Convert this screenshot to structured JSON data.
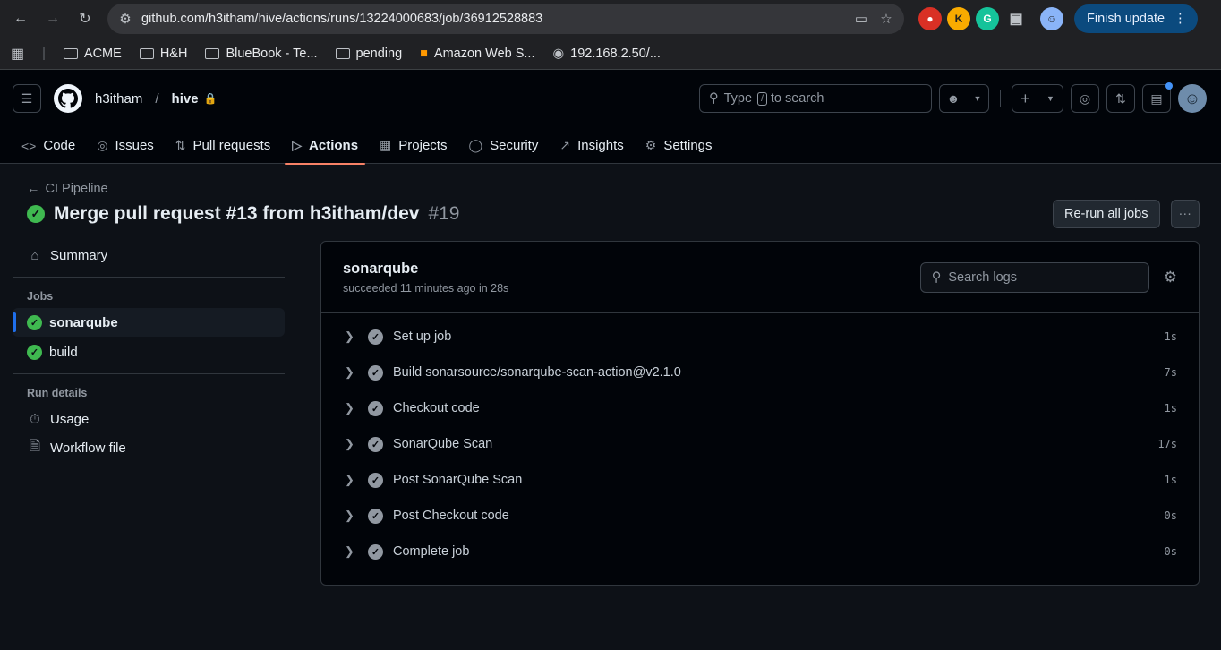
{
  "browser": {
    "url": "github.com/h3itham/hive/actions/runs/13224000683/job/36912528883",
    "finish_update": "Finish update",
    "bookmarks": [
      "ACME",
      "H&H",
      "BlueBook - Te...",
      "pending",
      "Amazon Web S...",
      "192.168.2.50/..."
    ]
  },
  "header": {
    "owner": "h3itham",
    "separator": "/",
    "repo": "hive",
    "search_placeholder_pre": "Type",
    "search_key": "/",
    "search_placeholder_post": "to search"
  },
  "tabs": [
    {
      "label": "Code",
      "icon": "code-icon"
    },
    {
      "label": "Issues",
      "icon": "issue-icon"
    },
    {
      "label": "Pull requests",
      "icon": "pull-request-icon"
    },
    {
      "label": "Actions",
      "icon": "play-icon"
    },
    {
      "label": "Projects",
      "icon": "table-icon"
    },
    {
      "label": "Security",
      "icon": "shield-icon"
    },
    {
      "label": "Insights",
      "icon": "graph-icon"
    },
    {
      "label": "Settings",
      "icon": "gear-icon"
    }
  ],
  "run": {
    "back_label": "CI Pipeline",
    "title": "Merge pull request #13 from h3itham/dev",
    "number": "#19",
    "rerun_label": "Re-run all jobs",
    "more_label": "···"
  },
  "sidebar": {
    "summary": "Summary",
    "jobs_heading": "Jobs",
    "jobs": [
      "sonarqube",
      "build"
    ],
    "run_details_heading": "Run details",
    "usage": "Usage",
    "workflow_file": "Workflow file"
  },
  "job": {
    "name": "sonarqube",
    "status_text": "succeeded 11 minutes ago in 28s",
    "search_placeholder": "Search logs",
    "steps": [
      {
        "name": "Set up job",
        "duration": "1s"
      },
      {
        "name": "Build sonarsource/sonarqube-scan-action@v2.1.0",
        "duration": "7s"
      },
      {
        "name": "Checkout code",
        "duration": "1s"
      },
      {
        "name": "SonarQube Scan",
        "duration": "17s"
      },
      {
        "name": "Post SonarQube Scan",
        "duration": "1s"
      },
      {
        "name": "Post Checkout code",
        "duration": "0s"
      },
      {
        "name": "Complete job",
        "duration": "0s"
      }
    ]
  }
}
